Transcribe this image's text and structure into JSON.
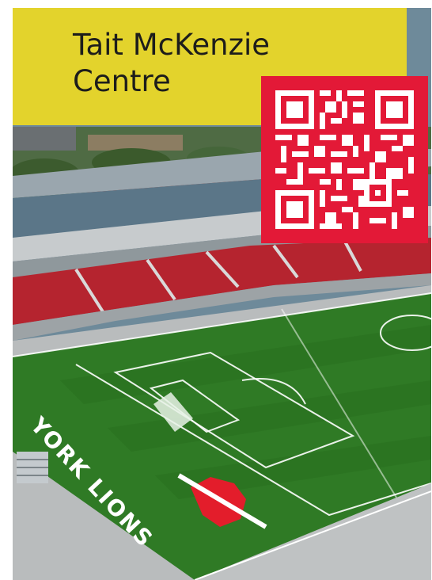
{
  "title": {
    "lines": [
      "Tait McKenzie",
      "Centre"
    ]
  },
  "qr": {
    "icon": "qr-code-icon",
    "background": "#e31937",
    "foreground": "#ffffff"
  },
  "photo": {
    "subject": "aerial-stadium-photo",
    "field_branding": "YORK LIONS"
  },
  "colors": {
    "title_background": "#e3d32c",
    "title_text": "#1d1d1b",
    "qr_background": "#e31937",
    "field_green": "#2f7a25",
    "seat_red": "#b5242f"
  }
}
